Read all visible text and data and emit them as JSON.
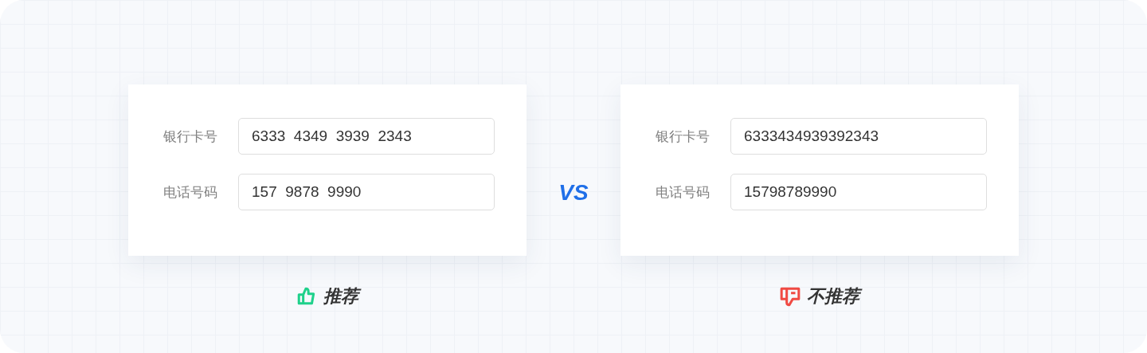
{
  "panels": [
    {
      "kind": "recommended",
      "fields": [
        {
          "label": "银行卡号",
          "value": "6333  4349  3939  2343"
        },
        {
          "label": "电话号码",
          "value": "157  9878  9990"
        }
      ],
      "verdict": "推荐"
    },
    {
      "kind": "not_recommended",
      "fields": [
        {
          "label": "银行卡号",
          "value": "6333434939392343"
        },
        {
          "label": "电话号码",
          "value": "15798789990"
        }
      ],
      "verdict": "不推荐"
    }
  ],
  "separator": "VS"
}
